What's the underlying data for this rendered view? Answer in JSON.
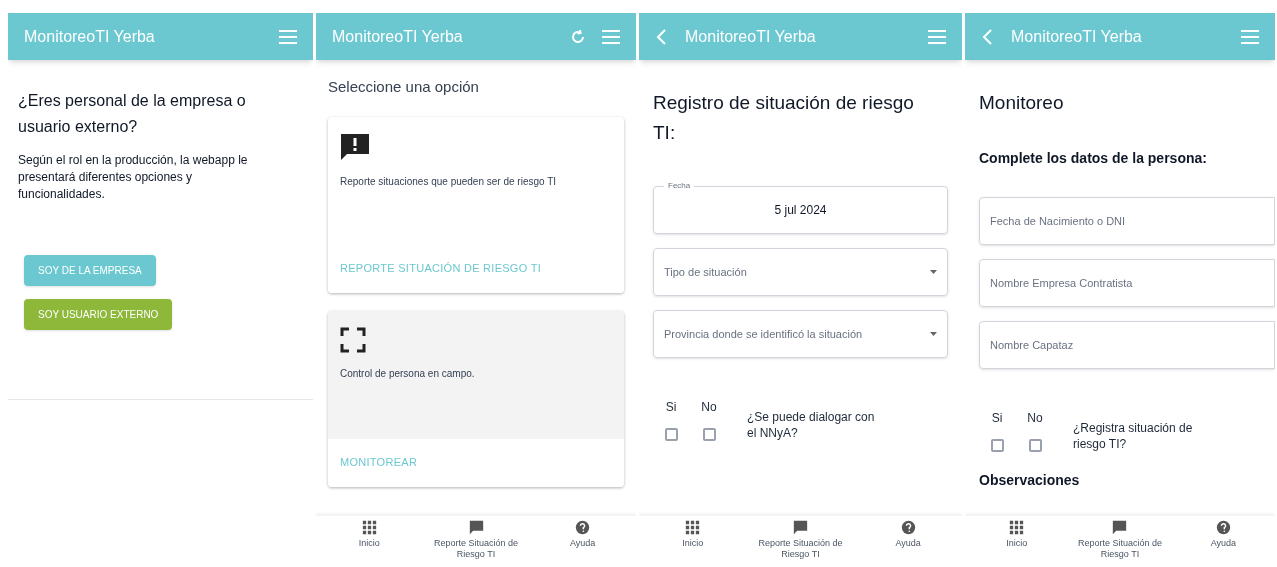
{
  "panels": [
    {
      "kind": "intro",
      "header": {
        "title": "MonitoreoTI Yerba",
        "back": false,
        "refresh": false
      },
      "heading": "¿Eres personal de la empresa o usuario externo?",
      "text": "Según el rol en la producción, la webapp le presentará diferentes opciones y funcionalidades.",
      "buttons": [
        {
          "label": "SOY DE LA EMPRESA",
          "color": "#6cc8d0"
        },
        {
          "label": "SOY USUARIO EXTERNO",
          "color": "#8db83a"
        }
      ]
    },
    {
      "kind": "options",
      "header": {
        "title": "MonitoreoTI Yerba",
        "back": false,
        "refresh": true
      },
      "heading": "Seleccione una opción",
      "cards": [
        {
          "text": "Reporte situaciones que pueden ser de riesgo TI",
          "action": "REPORTE SITUACIÓN DE RIESGO TI",
          "selected": false
        },
        {
          "text": "Control de persona en campo.",
          "action": "MONITOREAR",
          "selected": true
        }
      ],
      "nav": [
        "Inicio",
        "Reporte Situación de Riesgo TI",
        "Ayuda"
      ]
    },
    {
      "kind": "risk_form",
      "header": {
        "title": "MonitoreoTI Yerba",
        "back": true,
        "refresh": false
      },
      "heading": "Registro de situación de riesgo TI:",
      "fields": [
        {
          "kind": "date",
          "label": "Fecha",
          "value": "5 jul 2024"
        },
        {
          "kind": "select",
          "placeholder": "Tipo de situación"
        },
        {
          "kind": "select",
          "placeholder": "Provincia donde se identificó la situación"
        }
      ],
      "question": {
        "yes": "Si",
        "no": "No",
        "yes_checked": false,
        "no_checked": false,
        "text": "¿Se puede dialogar con el NNyA?"
      },
      "nav": [
        "Inicio",
        "Reporte Situación de Riesgo TI",
        "Ayuda"
      ]
    },
    {
      "kind": "monitor_form",
      "header": {
        "title": "MonitoreoTI Yerba",
        "back": true,
        "refresh": false
      },
      "heading": "Monitoreo",
      "subheading": "Complete los datos de la persona:",
      "fields": [
        {
          "kind": "text",
          "placeholder": "Fecha de Nacimiento o DNI"
        },
        {
          "kind": "text",
          "placeholder": "Nombre Empresa Contratista"
        },
        {
          "kind": "text",
          "placeholder": "Nombre Capataz"
        }
      ],
      "question": {
        "yes": "Si",
        "no": "No",
        "yes_checked": false,
        "no_checked": false,
        "text": "¿Registra situación de riesgo TI?"
      },
      "section": "Observaciones",
      "nav": [
        "Inicio",
        "Reporte Situación de Riesgo TI",
        "Ayuda"
      ]
    }
  ]
}
